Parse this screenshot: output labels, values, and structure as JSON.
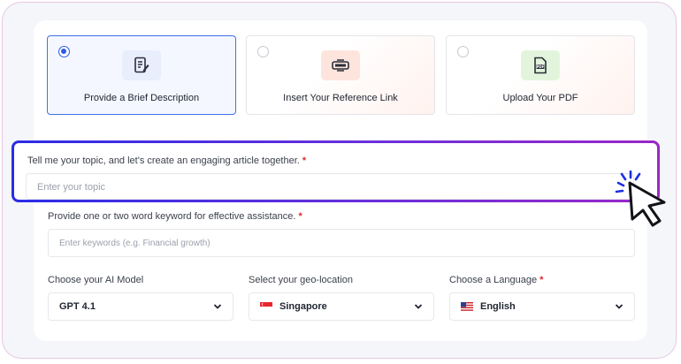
{
  "options": [
    {
      "label": "Provide a Brief Description",
      "icon": "document-edit-icon",
      "selected": true
    },
    {
      "label": "Insert Your Reference Link",
      "icon": "link-icon",
      "selected": false
    },
    {
      "label": "Upload Your PDF",
      "icon": "pdf-icon",
      "selected": false
    }
  ],
  "topic": {
    "label": "Tell me your topic, and let's create an engaging article together.",
    "required_mark": "*",
    "placeholder": "Enter your topic"
  },
  "keywords": {
    "label": "Provide one or two word keyword for effective assistance.",
    "required_mark": "*",
    "placeholder": "Enter keywords (e.g. Financial growth)"
  },
  "ai_model": {
    "label": "Choose your AI Model",
    "value": "GPT 4.1"
  },
  "geo": {
    "label": "Select your geo-location",
    "value": "Singapore",
    "flag": "singapore-flag"
  },
  "language": {
    "label": "Choose a Language",
    "required_mark": "*",
    "value": "English",
    "flag": "us-flag"
  },
  "colors": {
    "accent": "#2c5ae9",
    "gradient_start": "#2b2ce6",
    "gradient_end": "#9a27c8",
    "required": "#e3262b"
  }
}
